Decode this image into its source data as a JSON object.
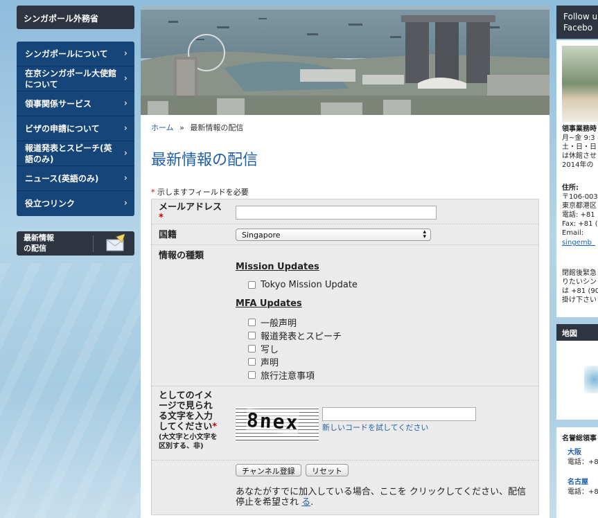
{
  "sidebar": {
    "site_title": "シンガポール外務省",
    "nav": [
      {
        "label": "シンガポールについて"
      },
      {
        "label": "在京シンガポール大使館について"
      },
      {
        "label": "領事関係サービス"
      },
      {
        "label": "ビザの申請について"
      },
      {
        "label": "報道発表とスピーチ(英語のみ)"
      },
      {
        "label": "ニュース(英語のみ)"
      },
      {
        "label": "役立つリンク"
      }
    ],
    "promo_line1": "最新情報",
    "promo_line2": "の配信"
  },
  "breadcrumb": {
    "home": "ホーム",
    "sep": "»",
    "current": "最新情報の配信"
  },
  "page_title": "最新情報の配信",
  "required_note": "示しますフィールドを必要",
  "form": {
    "email_label": "メールアドレス",
    "email_value": "",
    "nationality_label": "国籍",
    "nationality_value": "Singapore",
    "info_type_label": "情報の種類",
    "mission_group": "Mission Updates",
    "mission_items": [
      "Tokyo Mission Update"
    ],
    "mfa_group": "MFA Updates",
    "mfa_items": [
      "一般声明",
      "報道発表とスピーチ",
      "写し",
      "声明",
      "旅行注意事項"
    ],
    "captcha_label": "としてのイメージで見られる文字を入力してください",
    "captcha_hint": "(大文字と小文字を区別する、非)",
    "captcha_text": "8nex",
    "captcha_value": "",
    "new_code_link": "新しいコードを試してください",
    "subscribe_button": "チャンネル登録",
    "reset_button": "リセット",
    "unsubscribe_note": "あなたがすでに加入している場合、ここを クリックしてください、配信停止を希望され",
    "unsubscribe_link": "る"
  },
  "right": {
    "fb_line1": "Follow u",
    "fb_line2": "Facebo",
    "card_lines": [
      "領事業務時",
      "月~金 9:3",
      "土・日・日",
      "は休館させ",
      "2014年の",
      "住所:",
      "〒106-003",
      "東京都港区",
      "電話: +81",
      "Fax: +81 (",
      "Email:",
      "singemb_",
      "閉館後緊急",
      "りたいシン",
      "は +81 (90",
      "掛け下さい"
    ],
    "map_title": "地図",
    "hon_title": "名誉総領事",
    "hon_city1": "大阪",
    "hon_tel1": "電話：+8",
    "hon_city2": "名古屋",
    "hon_tel2": "電話：+8"
  },
  "colors": {
    "accent": "#1f5fa8",
    "nav_bg": "#16457a",
    "header_bg": "#2f3540",
    "required": "#cc0000"
  }
}
